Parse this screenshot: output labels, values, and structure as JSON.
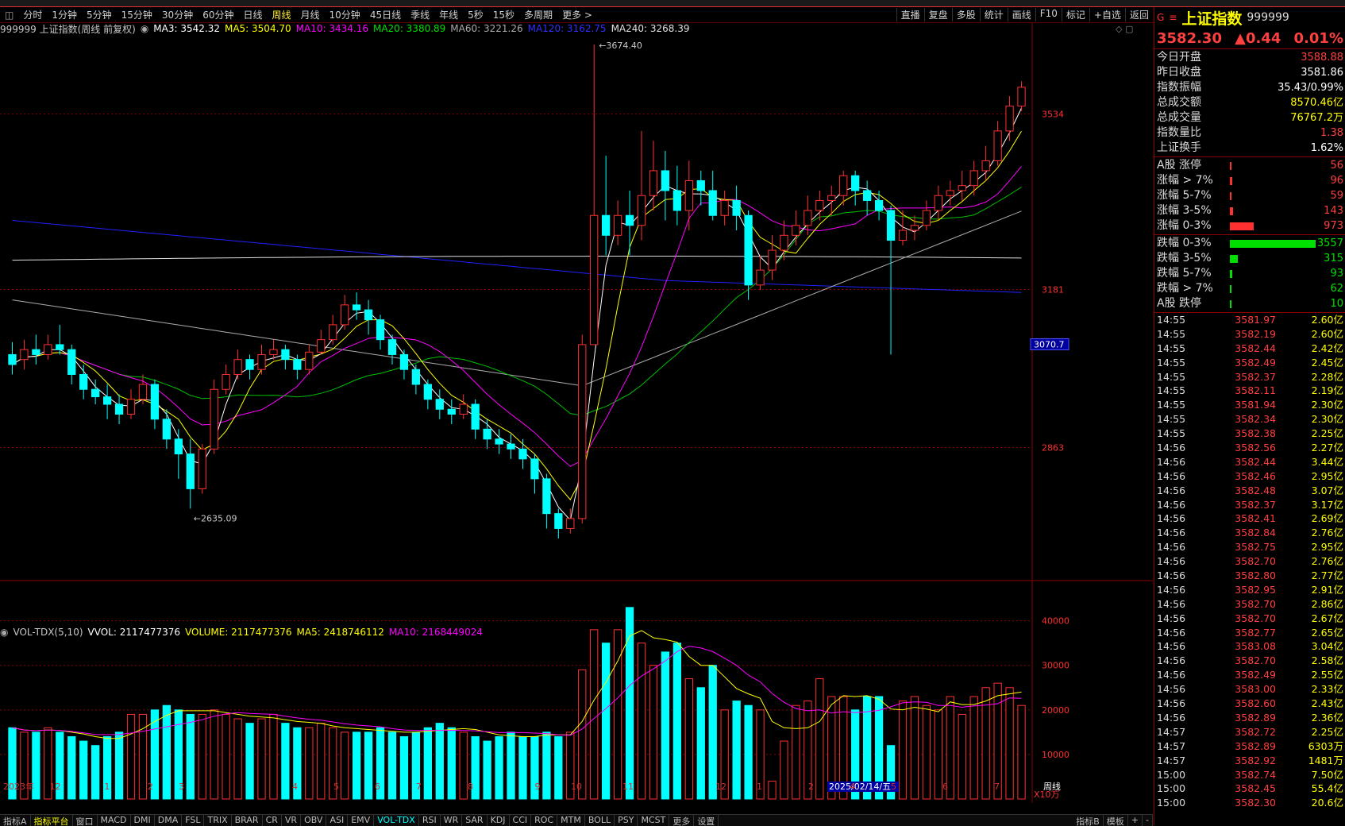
{
  "tabs": [
    "分时",
    "1分钟",
    "5分钟",
    "15分钟",
    "30分钟",
    "60分钟",
    "日线",
    "周线",
    "月线",
    "10分钟",
    "45日线",
    "季线",
    "年线",
    "5秒",
    "15秒",
    "多周期",
    "更多 >"
  ],
  "active_tab": "周线",
  "tools": [
    "直播",
    "复盘",
    "多股",
    "统计",
    "画线",
    "F10",
    "标记",
    "+自选",
    "返回"
  ],
  "legend": {
    "name": "999999 上证指数(周线 前复权)",
    "ma3": "MA3: 3542.32",
    "ma5": "MA5: 3504.70",
    "ma10": "MA10: 3434.16",
    "ma20": "MA20: 3380.89",
    "ma60": "MA60: 3221.26",
    "ma120": "MA120: 3162.75",
    "ma240": "MA240: 3268.39"
  },
  "annotations": {
    "high": "3674.40",
    "low": "2635.09",
    "crosshair_price": "3070.7"
  },
  "price_axis": [
    "3534",
    "3181",
    "2863"
  ],
  "vol_legend": {
    "title": "VOL-TDX(5,10)",
    "vvol": "VVOL: 2117477376",
    "volume": "VOLUME: 2117477376",
    "ma5": "MA5: 2418746112",
    "ma10": "MA10: 2168449024"
  },
  "vol_axis": [
    "40000",
    "30000",
    "20000",
    "10000",
    "X10万"
  ],
  "dates": [
    "2023年",
    "12",
    "1",
    "2",
    "3",
    "4",
    "5",
    "6",
    "7",
    "8",
    "9",
    "10",
    "11",
    "12",
    "1",
    "2",
    "2025/02/14/五",
    "4",
    "5",
    "6",
    "7"
  ],
  "period_label": "周线",
  "bottom_tabs": [
    "指标A",
    "指标平台",
    "窗口",
    "MACD",
    "DMI",
    "DMA",
    "FSL",
    "TRIX",
    "BRAR",
    "CR",
    "VR",
    "OBV",
    "ASI",
    "EMV",
    "VOL-TDX",
    "RSI",
    "WR",
    "SAR",
    "KDJ",
    "CCI",
    "ROC",
    "MTM",
    "BOLL",
    "PSY",
    "MCST",
    "更多",
    "设置"
  ],
  "bottom_right": [
    "指标B",
    "模板",
    "+",
    "-"
  ],
  "quote": {
    "symbol_icon": "G",
    "title": "上证指数",
    "code": "999999",
    "price": "3582.30",
    "change": "▲0.44",
    "pct": "0.01%",
    "stats": [
      {
        "label": "今日开盘",
        "value": "3588.88",
        "color": "red"
      },
      {
        "label": "昨日收盘",
        "value": "3581.86",
        "color": "white"
      },
      {
        "label": "指数振幅",
        "value": "35.43/0.99%",
        "color": "white"
      },
      {
        "label": "总成交额",
        "value": "8570.46亿",
        "color": "yellow"
      },
      {
        "label": "总成交量",
        "value": "76767.2万",
        "color": "yellow"
      },
      {
        "label": "指数量比",
        "value": "1.38",
        "color": "red"
      },
      {
        "label": "上证换手",
        "value": "1.62%",
        "color": "white"
      }
    ],
    "breadth_up": [
      {
        "label": "A股 涨停",
        "value": "56"
      },
      {
        "label": "涨幅 > 7%",
        "value": "96"
      },
      {
        "label": "涨幅 5-7%",
        "value": "59"
      },
      {
        "label": "涨幅 3-5%",
        "value": "143"
      },
      {
        "label": "涨幅 0-3%",
        "value": "973"
      }
    ],
    "breadth_down": [
      {
        "label": "跌幅 0-3%",
        "value": "3557"
      },
      {
        "label": "跌幅 3-5%",
        "value": "315"
      },
      {
        "label": "跌幅 5-7%",
        "value": "93"
      },
      {
        "label": "跌幅 > 7%",
        "value": "62"
      },
      {
        "label": "A股 跌停",
        "value": "10"
      }
    ],
    "ticks": [
      [
        "14:55",
        "3581.97",
        "2.60亿"
      ],
      [
        "14:55",
        "3582.19",
        "2.60亿"
      ],
      [
        "14:55",
        "3582.44",
        "2.42亿"
      ],
      [
        "14:55",
        "3582.49",
        "2.45亿"
      ],
      [
        "14:55",
        "3582.37",
        "2.28亿"
      ],
      [
        "14:55",
        "3582.11",
        "2.19亿"
      ],
      [
        "14:55",
        "3581.94",
        "2.30亿"
      ],
      [
        "14:55",
        "3582.34",
        "2.30亿"
      ],
      [
        "14:55",
        "3582.38",
        "2.25亿"
      ],
      [
        "14:56",
        "3582.56",
        "2.27亿"
      ],
      [
        "14:56",
        "3582.44",
        "3.44亿"
      ],
      [
        "14:56",
        "3582.46",
        "2.95亿"
      ],
      [
        "14:56",
        "3582.48",
        "3.07亿"
      ],
      [
        "14:56",
        "3582.37",
        "3.17亿"
      ],
      [
        "14:56",
        "3582.41",
        "2.69亿"
      ],
      [
        "14:56",
        "3582.84",
        "2.76亿"
      ],
      [
        "14:56",
        "3582.75",
        "2.95亿"
      ],
      [
        "14:56",
        "3582.70",
        "2.76亿"
      ],
      [
        "14:56",
        "3582.80",
        "2.77亿"
      ],
      [
        "14:56",
        "3582.95",
        "2.91亿"
      ],
      [
        "14:56",
        "3582.70",
        "2.86亿"
      ],
      [
        "14:56",
        "3582.70",
        "2.67亿"
      ],
      [
        "14:56",
        "3582.77",
        "2.65亿"
      ],
      [
        "14:56",
        "3583.08",
        "3.04亿"
      ],
      [
        "14:56",
        "3582.70",
        "2.58亿"
      ],
      [
        "14:56",
        "3582.49",
        "2.55亿"
      ],
      [
        "14:56",
        "3583.00",
        "2.33亿"
      ],
      [
        "14:56",
        "3582.60",
        "2.43亿"
      ],
      [
        "14:56",
        "3582.89",
        "2.36亿"
      ],
      [
        "14:57",
        "3582.72",
        "2.25亿"
      ],
      [
        "14:57",
        "3582.89",
        "6303万"
      ],
      [
        "14:57",
        "3582.92",
        "1481万"
      ],
      [
        "15:00",
        "3582.74",
        "7.50亿"
      ],
      [
        "15:00",
        "3582.45",
        "55.4亿"
      ],
      [
        "15:00",
        "3582.30",
        "20.6亿"
      ]
    ]
  },
  "colors": {
    "up": "#ff3030",
    "down": "#00ffff",
    "ma3": "#ffffff",
    "ma5": "#ffff00",
    "ma10": "#ff00ff",
    "ma20": "#00c000",
    "ma60": "#aaaaaa",
    "ma120": "#2020ff",
    "ma240": "#e0e0e0"
  },
  "chart_data": {
    "type": "candlestick",
    "title": "999999 上证指数(周线 前复权)",
    "candles": [
      [
        3050,
        3030,
        3075,
        3010
      ],
      [
        3040,
        3060,
        3080,
        3020
      ],
      [
        3060,
        3050,
        3090,
        3030
      ],
      [
        3050,
        3070,
        3090,
        3040
      ],
      [
        3070,
        3060,
        3110,
        3050
      ],
      [
        3060,
        3010,
        3070,
        2990
      ],
      [
        3010,
        2980,
        3030,
        2960
      ],
      [
        2980,
        2965,
        3000,
        2950
      ],
      [
        2965,
        2950,
        2990,
        2920
      ],
      [
        2950,
        2930,
        2970,
        2910
      ],
      [
        2930,
        2960,
        2980,
        2920
      ],
      [
        2960,
        2990,
        3010,
        2950
      ],
      [
        2990,
        2920,
        3000,
        2900
      ],
      [
        2920,
        2880,
        2940,
        2860
      ],
      [
        2880,
        2850,
        2900,
        2800
      ],
      [
        2850,
        2780,
        2880,
        2740
      ],
      [
        2780,
        2860,
        2870,
        2770
      ],
      [
        2860,
        2980,
        3000,
        2850
      ],
      [
        2980,
        3010,
        3030,
        2970
      ],
      [
        3010,
        3040,
        3060,
        3000
      ],
      [
        3040,
        3020,
        3050,
        3000
      ],
      [
        3020,
        3050,
        3070,
        3010
      ],
      [
        3050,
        3060,
        3080,
        3040
      ],
      [
        3060,
        3040,
        3070,
        3020
      ],
      [
        3040,
        3020,
        3050,
        3000
      ],
      [
        3020,
        3055,
        3070,
        3010
      ],
      [
        3055,
        3080,
        3100,
        3050
      ],
      [
        3080,
        3110,
        3130,
        3070
      ],
      [
        3110,
        3150,
        3170,
        3100
      ],
      [
        3150,
        3140,
        3175,
        3120
      ],
      [
        3140,
        3120,
        3160,
        3090
      ],
      [
        3120,
        3080,
        3130,
        3060
      ],
      [
        3080,
        3050,
        3090,
        3030
      ],
      [
        3050,
        3020,
        3060,
        3000
      ],
      [
        3020,
        2990,
        3030,
        2970
      ],
      [
        2990,
        2960,
        3000,
        2940
      ],
      [
        2960,
        2940,
        2980,
        2920
      ],
      [
        2940,
        2930,
        2960,
        2910
      ],
      [
        2930,
        2950,
        2970,
        2920
      ],
      [
        2950,
        2900,
        2960,
        2880
      ],
      [
        2900,
        2880,
        2920,
        2860
      ],
      [
        2880,
        2870,
        2900,
        2850
      ],
      [
        2870,
        2860,
        2890,
        2840
      ],
      [
        2860,
        2840,
        2880,
        2820
      ],
      [
        2840,
        2800,
        2850,
        2770
      ],
      [
        2800,
        2730,
        2810,
        2700
      ],
      [
        2730,
        2700,
        2740,
        2680
      ],
      [
        2700,
        2720,
        2740,
        2690
      ],
      [
        2720,
        3070,
        3090,
        2710
      ],
      [
        3070,
        3330,
        3674,
        3210
      ],
      [
        3330,
        3290,
        3450,
        3250
      ],
      [
        3290,
        3330,
        3360,
        3270
      ],
      [
        3330,
        3310,
        3380,
        3250
      ],
      [
        3310,
        3370,
        3500,
        3280
      ],
      [
        3370,
        3420,
        3480,
        3340
      ],
      [
        3420,
        3380,
        3460,
        3320
      ],
      [
        3380,
        3340,
        3430,
        3310
      ],
      [
        3340,
        3400,
        3440,
        3300
      ],
      [
        3400,
        3380,
        3420,
        3350
      ],
      [
        3380,
        3330,
        3420,
        3320
      ],
      [
        3330,
        3360,
        3380,
        3310
      ],
      [
        3360,
        3330,
        3390,
        3300
      ],
      [
        3330,
        3190,
        3340,
        3160
      ],
      [
        3190,
        3220,
        3250,
        3180
      ],
      [
        3220,
        3260,
        3290,
        3200
      ],
      [
        3260,
        3290,
        3320,
        3240
      ],
      [
        3290,
        3310,
        3340,
        3270
      ],
      [
        3310,
        3340,
        3370,
        3290
      ],
      [
        3340,
        3360,
        3380,
        3320
      ],
      [
        3360,
        3370,
        3390,
        3330
      ],
      [
        3370,
        3410,
        3420,
        3350
      ],
      [
        3410,
        3380,
        3420,
        3350
      ],
      [
        3380,
        3360,
        3400,
        3330
      ],
      [
        3360,
        3340,
        3380,
        3320
      ],
      [
        3340,
        3280,
        3350,
        3050
      ],
      [
        3280,
        3300,
        3340,
        3270
      ],
      [
        3300,
        3310,
        3330,
        3280
      ],
      [
        3310,
        3340,
        3360,
        3300
      ],
      [
        3340,
        3370,
        3390,
        3320
      ],
      [
        3370,
        3380,
        3400,
        3350
      ],
      [
        3380,
        3390,
        3420,
        3360
      ],
      [
        3390,
        3420,
        3440,
        3370
      ],
      [
        3420,
        3440,
        3470,
        3400
      ],
      [
        3440,
        3500,
        3520,
        3430
      ],
      [
        3500,
        3550,
        3570,
        3480
      ],
      [
        3550,
        3588,
        3600,
        3540
      ]
    ],
    "volumes": [
      160,
      150,
      150,
      160,
      150,
      140,
      130,
      120,
      140,
      150,
      190,
      190,
      200,
      210,
      200,
      190,
      190,
      200,
      190,
      180,
      170,
      180,
      190,
      170,
      160,
      160,
      170,
      160,
      150,
      150,
      150,
      160,
      150,
      140,
      150,
      160,
      170,
      160,
      150,
      140,
      130,
      140,
      150,
      140,
      140,
      150,
      140,
      150,
      290,
      380,
      350,
      380,
      430,
      350,
      300,
      330,
      350,
      270,
      250,
      300,
      200,
      220,
      210,
      200,
      40,
      130,
      210,
      220,
      270,
      230,
      230,
      200,
      230,
      230,
      120,
      220,
      230,
      210,
      200,
      230,
      190,
      230,
      250,
      260,
      250,
      210
    ],
    "price_range": [
      2600,
      3690
    ],
    "volume_range": [
      0,
      460
    ]
  }
}
